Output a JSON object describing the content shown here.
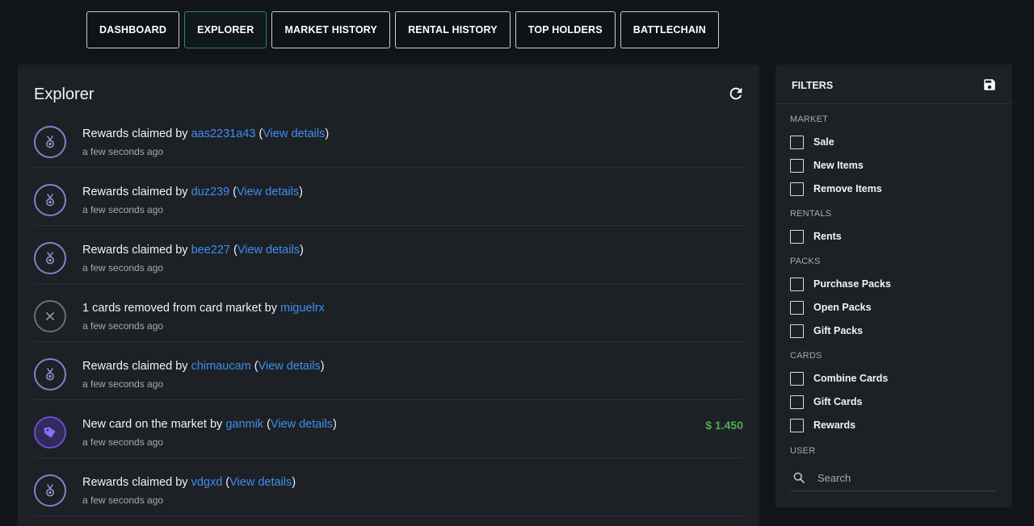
{
  "nav": {
    "tabs": [
      {
        "label": "DASHBOARD",
        "active": false
      },
      {
        "label": "EXPLORER",
        "active": true
      },
      {
        "label": "MARKET HISTORY",
        "active": false
      },
      {
        "label": "RENTAL HISTORY",
        "active": false
      },
      {
        "label": "TOP HOLDERS",
        "active": false
      },
      {
        "label": "BATTLECHAIN",
        "active": false
      }
    ]
  },
  "explorer": {
    "title": "Explorer",
    "refresh_icon": "refresh-icon",
    "view_details_label": "View details",
    "events": [
      {
        "type": "reward",
        "icon": "medal-icon",
        "prefix": "Rewards claimed by ",
        "user": "aas2231a43",
        "details": true,
        "time": "a few seconds ago",
        "price": ""
      },
      {
        "type": "reward",
        "icon": "medal-icon",
        "prefix": "Rewards claimed by ",
        "user": "duz239",
        "details": true,
        "time": "a few seconds ago",
        "price": ""
      },
      {
        "type": "reward",
        "icon": "medal-icon",
        "prefix": "Rewards claimed by ",
        "user": "bee227",
        "details": true,
        "time": "a few seconds ago",
        "price": ""
      },
      {
        "type": "removed",
        "icon": "close-icon",
        "prefix": "1 cards removed from card market by ",
        "user": "miguelrx",
        "details": false,
        "time": "a few seconds ago",
        "price": ""
      },
      {
        "type": "reward",
        "icon": "medal-icon",
        "prefix": "Rewards claimed by ",
        "user": "chimaucam",
        "details": true,
        "time": "a few seconds ago",
        "price": ""
      },
      {
        "type": "sale",
        "icon": "tag-icon",
        "prefix": "New card on the market by ",
        "user": "ganmik",
        "details": true,
        "time": "a few seconds ago",
        "price": "$ 1.450"
      },
      {
        "type": "reward",
        "icon": "medal-icon",
        "prefix": "Rewards claimed by ",
        "user": "vdgxd",
        "details": true,
        "time": "a few seconds ago",
        "price": ""
      }
    ]
  },
  "filters": {
    "title": "FILTERS",
    "save_icon": "save-icon",
    "sections": [
      {
        "label": "MARKET",
        "options": [
          "Sale",
          "New Items",
          "Remove Items"
        ]
      },
      {
        "label": "RENTALS",
        "options": [
          "Rents"
        ]
      },
      {
        "label": "PACKS",
        "options": [
          "Purchase Packs",
          "Open Packs",
          "Gift Packs"
        ]
      },
      {
        "label": "CARDS",
        "options": [
          "Combine Cards",
          "Gift Cards",
          "Rewards"
        ]
      }
    ],
    "user_label": "USER",
    "search_placeholder": "Search",
    "search_value": ""
  },
  "colors": {
    "background": "#111418",
    "panel": "#1d2025",
    "link": "#3d8ff0",
    "price": "#4caf50",
    "active_tab_border": "#2b7f86"
  }
}
